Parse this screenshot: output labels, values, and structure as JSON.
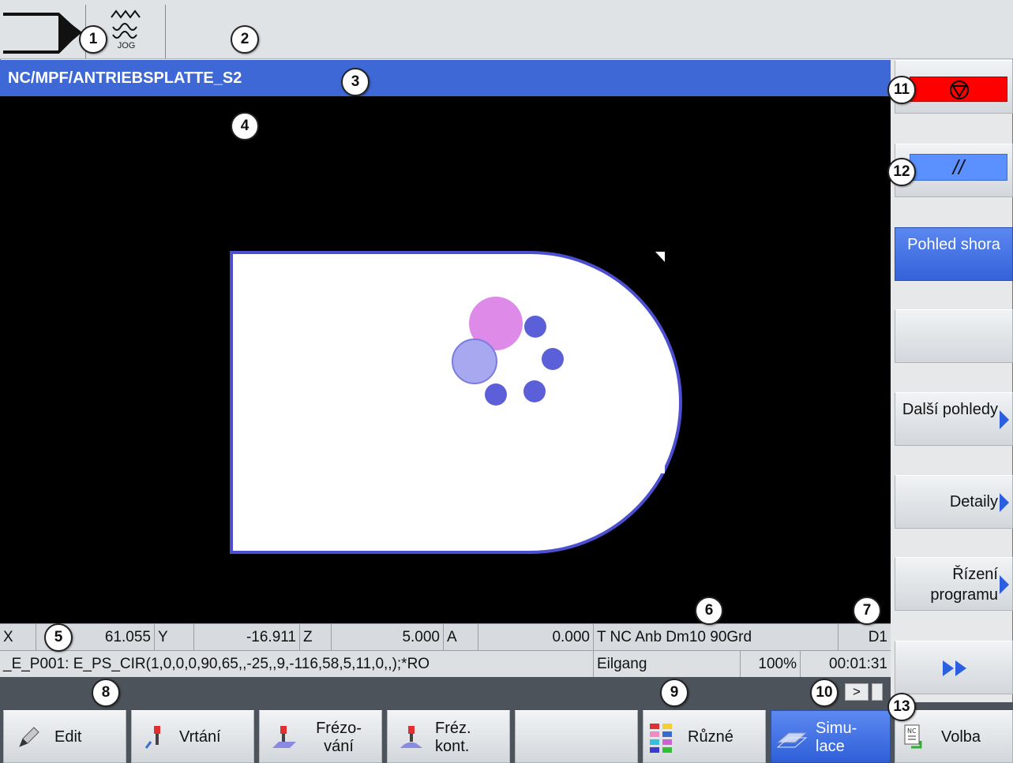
{
  "header": {
    "mode_label": "JOG",
    "program_path": "NC/MPF/ANTRIEBSPLATTE_S2"
  },
  "status": {
    "axes": [
      {
        "name": "X",
        "value": "61.055"
      },
      {
        "name": "Y",
        "value": "-16.911"
      },
      {
        "name": "Z",
        "value": "5.000"
      },
      {
        "name": "A",
        "value": "0.000"
      }
    ],
    "tool": "T NC Anb Dm10 90Grd",
    "d_number": "D1",
    "block": "_E_P001: E_PS_CIR(1,0,0,0,90,65,,-25,,9,-116,58,5,11,0,,);*RO",
    "feed_mode": "Eilgang",
    "override": "100%",
    "time": "00:01:31",
    "next_arrow": ">"
  },
  "right_softkeys": [
    {
      "label": "",
      "icon": "stop-icon"
    },
    {
      "label": "//",
      "icon": "skip-block-icon"
    },
    {
      "label": "Pohled shora",
      "active": true
    },
    {
      "label": ""
    },
    {
      "label": "Další pohledy",
      "has_arrow": true
    },
    {
      "label": "Detaily",
      "has_arrow": true
    },
    {
      "label": "Řízení programu",
      "has_arrow": true
    },
    {
      "label": "",
      "icon": "fast-forward-icon"
    }
  ],
  "bottom_softkeys": [
    {
      "label": "Edit",
      "icon": "edit-pencil-icon"
    },
    {
      "label": "Vrtání",
      "icon": "drill-icon"
    },
    {
      "label": "Frézo- vání",
      "icon": "mill-icon"
    },
    {
      "label": "Fréz. kont.",
      "icon": "contour-mill-icon"
    },
    {
      "label": ""
    },
    {
      "label": "Různé",
      "icon": "various-colors-icon"
    },
    {
      "label": "Simu- lace",
      "icon": "simulation-icon",
      "active": true
    },
    {
      "label": "Volba",
      "icon": "nc-select-icon"
    }
  ],
  "callouts": [
    "1",
    "2",
    "3",
    "4",
    "5",
    "6",
    "7",
    "8",
    "9",
    "10",
    "11",
    "12",
    "13"
  ],
  "colors": {
    "path_bar": "#3d68d6",
    "stop_red": "#ff0000",
    "active_blue": "#3563d8",
    "workpiece": "#ffffff",
    "hole_blue": "#5b5fd8",
    "tool_pink": "#de8ae8",
    "tool_light_blue": "#a7a8f0"
  }
}
